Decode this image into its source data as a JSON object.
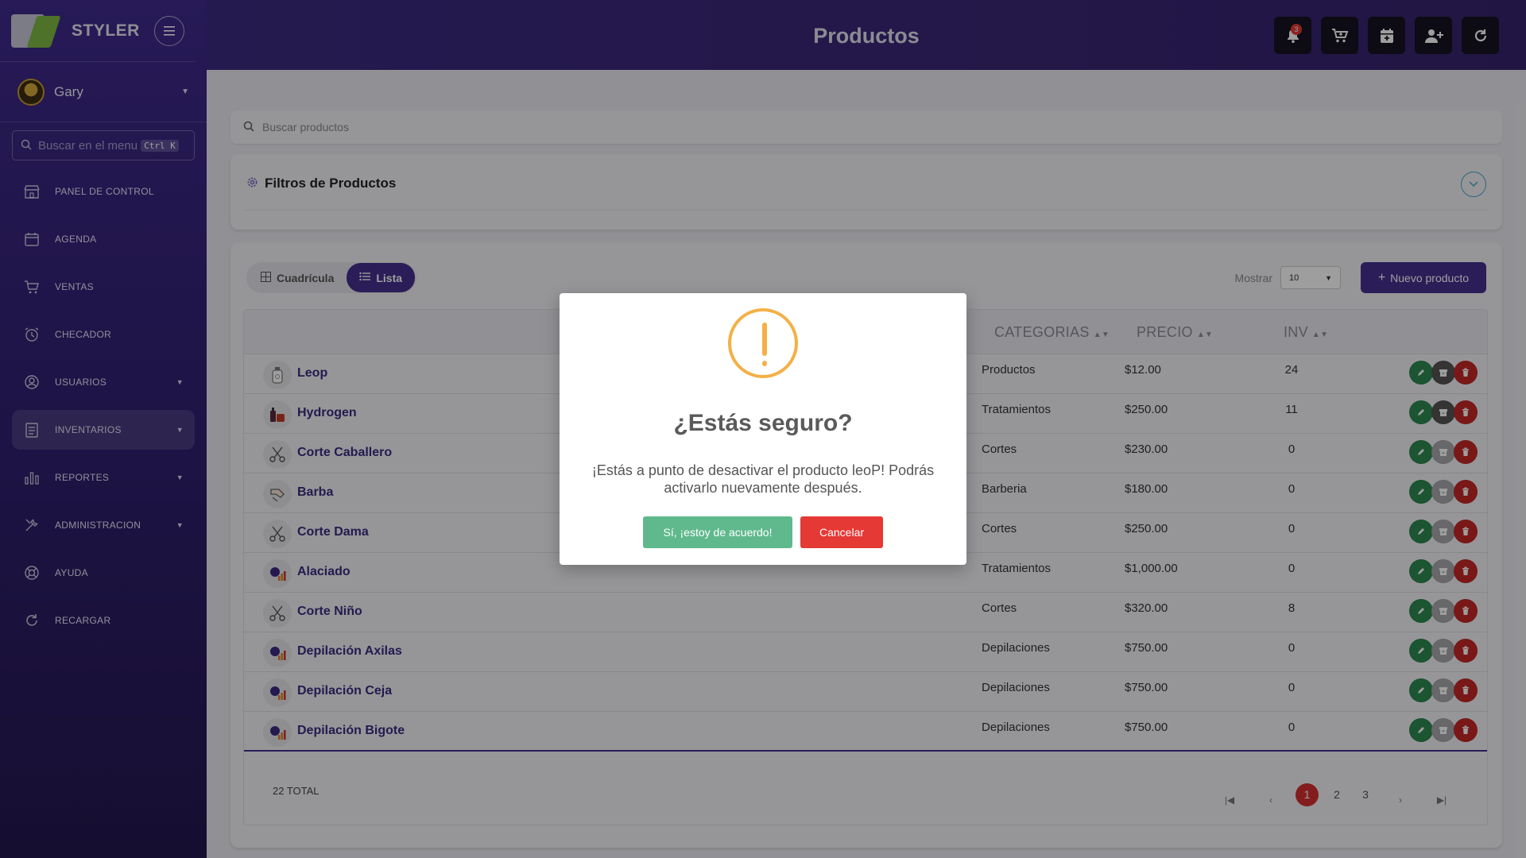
{
  "app": {
    "brand": "STYLER",
    "page_title": "Productos"
  },
  "sidebar": {
    "user_name": "Gary",
    "search_placeholder": "Buscar en el menu",
    "search_shortcut": "Ctrl K",
    "items": [
      {
        "label": "PANEL DE CONTROL",
        "icon": "store-icon",
        "has_caret": false
      },
      {
        "label": "AGENDA",
        "icon": "calendar-icon",
        "has_caret": false
      },
      {
        "label": "VENTAS",
        "icon": "cart-icon",
        "has_caret": false
      },
      {
        "label": "CHECADOR",
        "icon": "alarm-clock-icon",
        "has_caret": false
      },
      {
        "label": "USUARIOS",
        "icon": "user-circle-icon",
        "has_caret": true
      },
      {
        "label": "INVENTARIOS",
        "icon": "clipboard-list-icon",
        "has_caret": true
      },
      {
        "label": "REPORTES",
        "icon": "bar-chart-icon",
        "has_caret": true
      },
      {
        "label": "ADMINISTRACION",
        "icon": "tools-icon",
        "has_caret": true
      },
      {
        "label": "AYUDA",
        "icon": "lifebuoy-icon",
        "has_caret": false
      },
      {
        "label": "RECARGAR",
        "icon": "reload-icon",
        "has_caret": false
      }
    ],
    "active_item": "INVENTARIOS"
  },
  "header": {
    "notifications_count": "3",
    "actions": [
      "bell-icon",
      "cart-plus-icon",
      "calendar-plus-icon",
      "user-plus-icon",
      "refresh-icon"
    ]
  },
  "search": {
    "placeholder": "Buscar productos"
  },
  "filters": {
    "title": "Filtros de Productos"
  },
  "view": {
    "grid_label": "Cuadrícula",
    "list_label": "Lista",
    "active": "Lista"
  },
  "show": {
    "label": "Mostrar",
    "value": "10"
  },
  "new_product_label": "Nuevo producto",
  "table": {
    "columns": {
      "categories": "CATEGORIAS",
      "price": "PRECIO",
      "inv": "INV"
    },
    "rows": [
      {
        "name": "Leop",
        "category": "Productos",
        "price": "$12.00",
        "inv": "24",
        "thumb": "bottle-icon",
        "disable_active": true
      },
      {
        "name": "Hydrogen",
        "category": "Tratamientos",
        "price": "$250.00",
        "inv": "11",
        "thumb": "cosmetics-icon",
        "disable_active": true
      },
      {
        "name": "Corte Caballero",
        "category": "Cortes",
        "price": "$230.00",
        "inv": "0",
        "thumb": "scissors-icon",
        "disable_active": false
      },
      {
        "name": "Barba",
        "category": "Barberia",
        "price": "$180.00",
        "inv": "0",
        "thumb": "razor-icon",
        "disable_active": false
      },
      {
        "name": "Corte Dama",
        "category": "Cortes",
        "price": "$250.00",
        "inv": "0",
        "thumb": "scissors-icon",
        "disable_active": false
      },
      {
        "name": "Alaciado",
        "category": "Tratamientos",
        "price": "$1,000.00",
        "inv": "0",
        "thumb": "service-icon",
        "disable_active": false
      },
      {
        "name": "Corte Niño",
        "category": "Cortes",
        "price": "$320.00",
        "inv": "8",
        "thumb": "scissors-icon",
        "disable_active": false
      },
      {
        "name": "Depilación Axilas",
        "category": "Depilaciones",
        "price": "$750.00",
        "inv": "0",
        "thumb": "service-icon",
        "disable_active": false
      },
      {
        "name": "Depilación Ceja",
        "category": "Depilaciones",
        "price": "$750.00",
        "inv": "0",
        "thumb": "service-icon",
        "disable_active": false
      },
      {
        "name": "Depilación Bigote",
        "category": "Depilaciones",
        "price": "$750.00",
        "inv": "0",
        "thumb": "service-icon",
        "disable_active": false
      }
    ],
    "total_label": "22 TOTAL",
    "pages": [
      "1",
      "2",
      "3"
    ],
    "current_page": "1"
  },
  "dialog": {
    "title": "¿Estás seguro?",
    "message": "¡Estás a punto de desactivar el producto leoP! Podrás activarlo nuevamente después.",
    "confirm_label": "Sí, ¡estoy de acuerdo!",
    "cancel_label": "Cancelar"
  },
  "colors": {
    "primary": "#45308f",
    "confirm": "#5fb98d",
    "danger": "#e53935",
    "warning": "#f4b046"
  }
}
